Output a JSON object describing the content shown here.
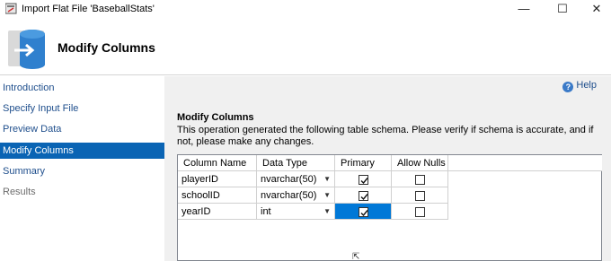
{
  "window": {
    "title": "Import Flat File 'BaseballStats'",
    "minimize_glyph": "—",
    "maximize_glyph": "☐",
    "close_glyph": "✕"
  },
  "header": {
    "title": "Modify Columns",
    "icon": "import-database-icon"
  },
  "nav": {
    "items": [
      {
        "label": "Introduction",
        "state": "link"
      },
      {
        "label": "Specify Input File",
        "state": "link"
      },
      {
        "label": "Preview Data",
        "state": "link"
      },
      {
        "label": "Modify Columns",
        "state": "active"
      },
      {
        "label": "Summary",
        "state": "link"
      },
      {
        "label": "Results",
        "state": "disabled"
      }
    ]
  },
  "main": {
    "help_label": "Help",
    "section_title": "Modify Columns",
    "description": "This operation generated the following table schema. Please verify if schema is accurate, and if not, please make any changes."
  },
  "grid": {
    "columns": [
      "Column Name",
      "Data Type",
      "Primary Key",
      "Allow Nulls"
    ],
    "rows": [
      {
        "name": "playerID",
        "type": "nvarchar(50)",
        "primary_key": true,
        "allow_nulls": false
      },
      {
        "name": "schoolID",
        "type": "nvarchar(50)",
        "primary_key": true,
        "allow_nulls": false
      },
      {
        "name": "yearID",
        "type": "int",
        "primary_key": true,
        "allow_nulls": false
      }
    ]
  },
  "colors": {
    "accent": "#0a64b4",
    "link": "#1e4e8c",
    "selection": "#0078d7",
    "panel": "#f0f0f0"
  }
}
